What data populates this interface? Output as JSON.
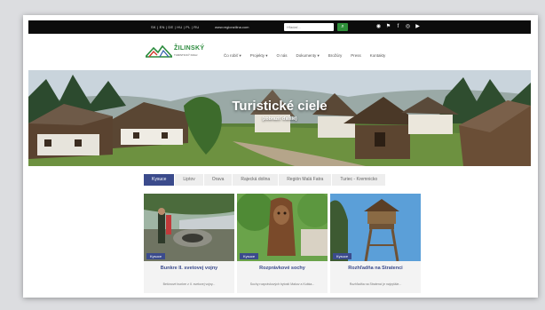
{
  "topbar": {
    "languages": "SK | EN | DE | HU | PL | RU",
    "site_url": "www.regionzilina.com",
    "search_placeholder": "Hľadať...",
    "search_icon": "search-icon",
    "social_icons": [
      "tripadvisor-icon",
      "foursquare-icon",
      "facebook-icon",
      "instagram-icon",
      "youtube-icon"
    ]
  },
  "logo": {
    "name": "ŽILINSKÝ",
    "subtitle": "TURISTICKÝ KRAJ"
  },
  "nav": [
    "Čo robiť ▾",
    "Projekty ▾",
    "O nás",
    "Dokumenty ▾",
    "Brožúry",
    "Press",
    "Kontakty"
  ],
  "hero": {
    "title": "Turistické ciele",
    "link": "(zobraziť ďalšie)"
  },
  "tabs": [
    {
      "label": "Kysuce",
      "active": true
    },
    {
      "label": "Liptov",
      "active": false
    },
    {
      "label": "Orava",
      "active": false
    },
    {
      "label": "Rajecká dolina",
      "active": false
    },
    {
      "label": "Región Malá Fatra",
      "active": false
    },
    {
      "label": "Turiec - Kremnicko",
      "active": false
    }
  ],
  "cards": [
    {
      "badge": "Kysuce",
      "title": "Bunkre II. svetovej vojny",
      "text": "Betónové bunkre z II. svetovej vojny..."
    },
    {
      "badge": "Kysuce",
      "title": "Rozprávkové sochy",
      "text": "Sochy rozprávkových bytostí Makov a Kubka..."
    },
    {
      "badge": "Kysuce",
      "title": "Rozhľadňa na Stratenci",
      "text": "Rozhľadňa na Stratenci je najvyššie..."
    }
  ],
  "colors": {
    "accent": "#3b4b8c",
    "brand_green": "#2a8a3c",
    "topbar": "#0c0c0c"
  }
}
